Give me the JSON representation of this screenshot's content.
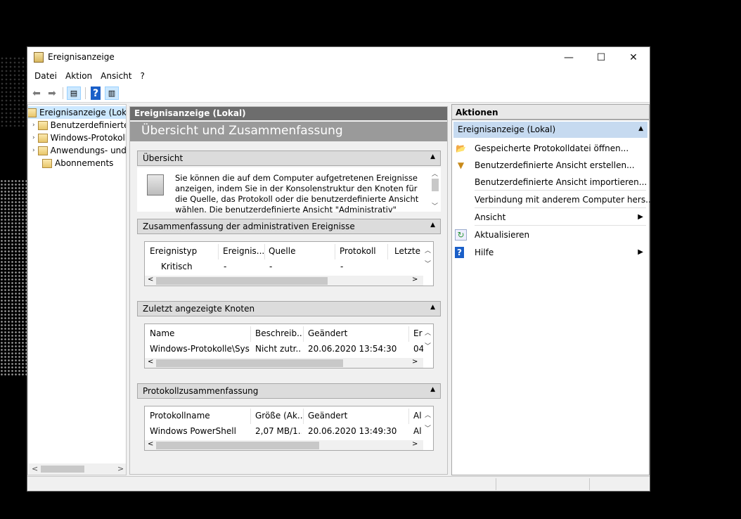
{
  "window": {
    "title": "Ereignisanzeige",
    "minimize": "—",
    "maximize": "☐",
    "close": "✕"
  },
  "menu": [
    "Datei",
    "Aktion",
    "Ansicht",
    "?"
  ],
  "tree": {
    "items": [
      {
        "label": "Ereignisanzeige (Lokal)",
        "expander": ""
      },
      {
        "label": "Benutzerdefinierte Ansichten",
        "expander": "›"
      },
      {
        "label": "Windows-Protokolle",
        "expander": "›"
      },
      {
        "label": "Anwendungs- und Dienstprotokolle",
        "expander": "›"
      },
      {
        "label": "Abonnements",
        "expander": ""
      }
    ]
  },
  "middle": {
    "header": "Ereignisanzeige (Lokal)",
    "title": "Übersicht und Zusammenfassung",
    "overview": {
      "header": "Übersicht",
      "text": "Sie können die auf dem Computer aufgetretenen Ereignisse anzeigen, indem Sie in der Konsolenstruktur den Knoten für die Quelle, das Protokoll oder die benutzerdefinierte Ansicht wählen. Die benutzerdefinierte Ansicht \"Administrativ\" enthält alle"
    },
    "admin": {
      "header": "Zusammenfassung der administrativen Ereignisse",
      "columns": [
        "Ereignistyp",
        "Ereignis...",
        "Quelle",
        "Protokoll",
        "Letzte St"
      ],
      "row": [
        "Kritisch",
        "-",
        "-",
        "-",
        ""
      ]
    },
    "recent": {
      "header": "Zuletzt angezeigte Knoten",
      "columns": [
        "Name",
        "Beschreib...",
        "Geändert",
        "Er"
      ],
      "row": [
        "Windows-Protokolle\\Sys...",
        "Nicht zutr...",
        "20.06.2020 13:54:30",
        "04"
      ]
    },
    "logs": {
      "header": "Protokollzusammenfassung",
      "columns": [
        "Protokollname",
        "Größe (Ak...",
        "Geändert",
        "Al"
      ],
      "row": [
        "Windows PowerShell",
        "2,07 MB/1...",
        "20.06.2020 13:49:30",
        "Al"
      ]
    }
  },
  "actions": {
    "header": "Aktionen",
    "group": "Ereignisanzeige (Lokal)",
    "items": [
      {
        "label": "Gespeicherte Protokolldatei öffnen...",
        "icon": "folder-open-icon"
      },
      {
        "label": "Benutzerdefinierte Ansicht erstellen...",
        "icon": "filter-icon"
      },
      {
        "label": "Benutzerdefinierte Ansicht importieren...",
        "icon": ""
      },
      {
        "label": "Verbindung mit anderem Computer hers...",
        "icon": ""
      },
      {
        "label": "Ansicht",
        "icon": ""
      },
      {
        "label": "Aktualisieren",
        "icon": "refresh-icon"
      },
      {
        "label": "Hilfe",
        "icon": "help-icon"
      }
    ]
  },
  "colors": {
    "accent": "#c6daf0",
    "header_gray": "#6d6d6d",
    "title_gray": "#9a9a9a"
  }
}
